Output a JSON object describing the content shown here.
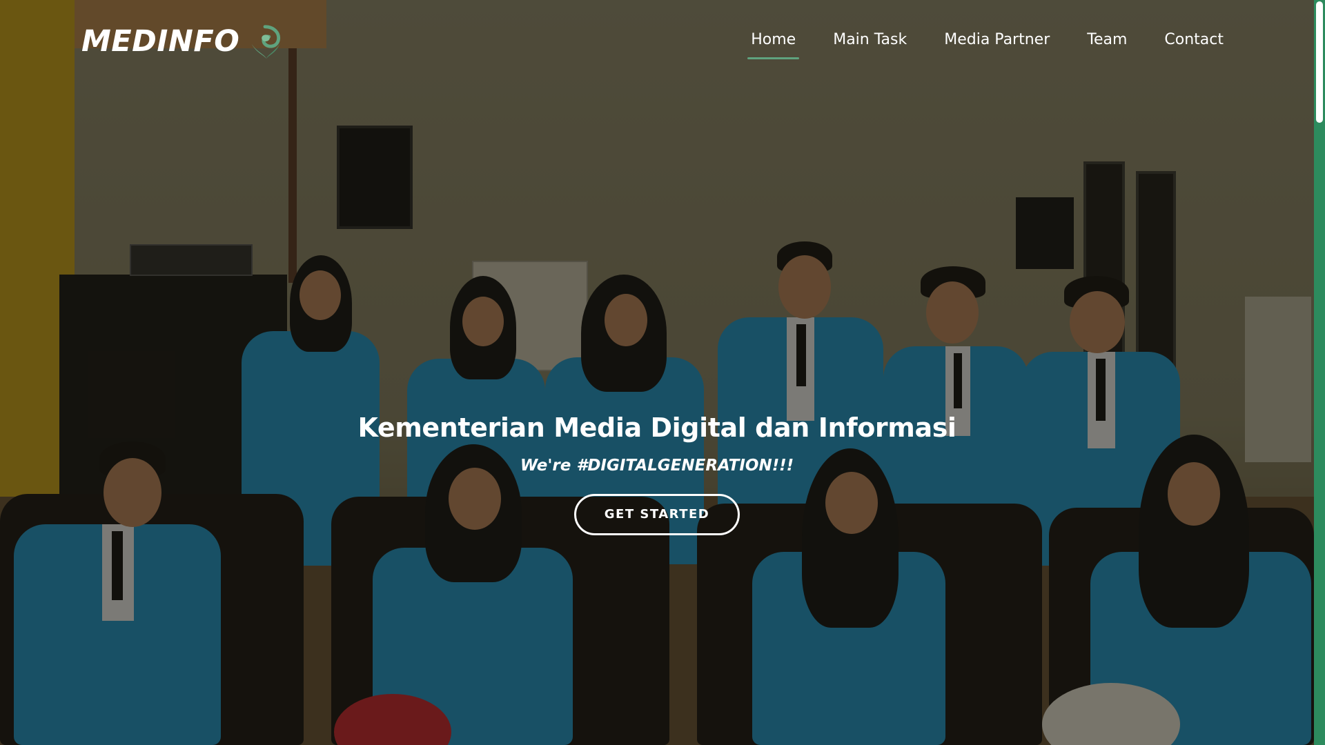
{
  "brand": {
    "name": "MEDINFO",
    "logo_icon": "leaf-swirl-icon",
    "accent_color": "#5fa37e",
    "scrollbar_color": "#2d8b5e"
  },
  "nav": {
    "items": [
      {
        "label": "Home",
        "active": true
      },
      {
        "label": "Main Task",
        "active": false
      },
      {
        "label": "Media Partner",
        "active": false
      },
      {
        "label": "Team",
        "active": false
      },
      {
        "label": "Contact",
        "active": false
      }
    ]
  },
  "hero": {
    "title": "Kementerian Media Digital dan Informasi",
    "tagline": "We're #DIGITALGENERATION!!!",
    "cta_label": "GET STARTED"
  }
}
